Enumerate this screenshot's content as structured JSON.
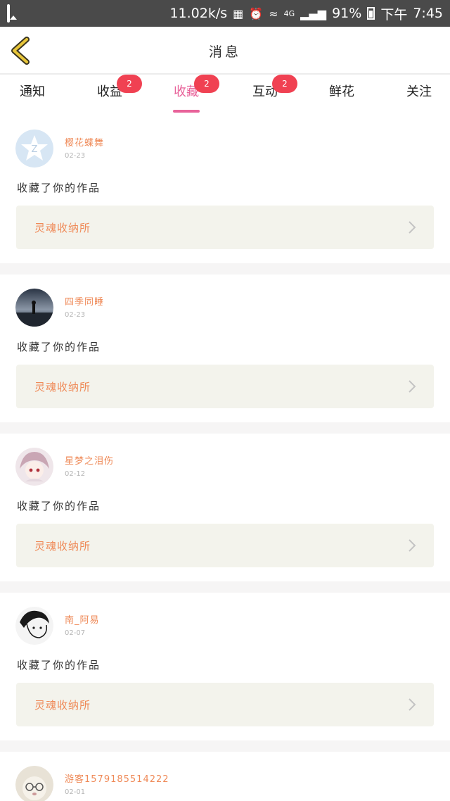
{
  "status_bar": {
    "speed": "11.02k/s",
    "network": "4G",
    "battery": "91%",
    "period": "下午",
    "time": "7:45",
    "icons": [
      "image-icon",
      "sim-icon",
      "alarm-icon",
      "wifi-icon",
      "signal-icon",
      "battery-icon"
    ]
  },
  "header": {
    "title": "消息",
    "back_icon": "chevron-left-icon",
    "accent": "#e8c63a"
  },
  "tabs": [
    {
      "label": "通知",
      "badge": null,
      "active": false
    },
    {
      "label": "收益",
      "badge": "2",
      "active": false
    },
    {
      "label": "收藏",
      "badge": "2",
      "active": true
    },
    {
      "label": "互动",
      "badge": "2",
      "active": false
    },
    {
      "label": "鲜花",
      "badge": null,
      "active": false
    },
    {
      "label": "关注",
      "badge": null,
      "active": false
    }
  ],
  "colors": {
    "active_tab": "#e8639a",
    "badge": "#f04152",
    "username": "#ef8a58",
    "card_target_bg": "#f3f3ec"
  },
  "items": [
    {
      "user": "樱花蝶舞",
      "date": "02-23",
      "action": "收藏了你的作品",
      "target": "灵魂收纳所",
      "avatar_icon": "default-avatar-icon"
    },
    {
      "user": "四季同睡",
      "date": "02-23",
      "action": "收藏了你的作品",
      "target": "灵魂收纳所",
      "avatar_icon": "photo-avatar-icon"
    },
    {
      "user": "星梦之泪伤",
      "date": "02-12",
      "action": "收藏了你的作品",
      "target": "灵魂收纳所",
      "avatar_icon": "anime-avatar-icon"
    },
    {
      "user": "南_阿易",
      "date": "02-07",
      "action": "收藏了你的作品",
      "target": "灵魂收纳所",
      "avatar_icon": "sketch-avatar-icon"
    },
    {
      "user": "游客1579185514222",
      "date": "02-01",
      "action": "",
      "target": "",
      "avatar_icon": "cat-avatar-icon"
    }
  ]
}
